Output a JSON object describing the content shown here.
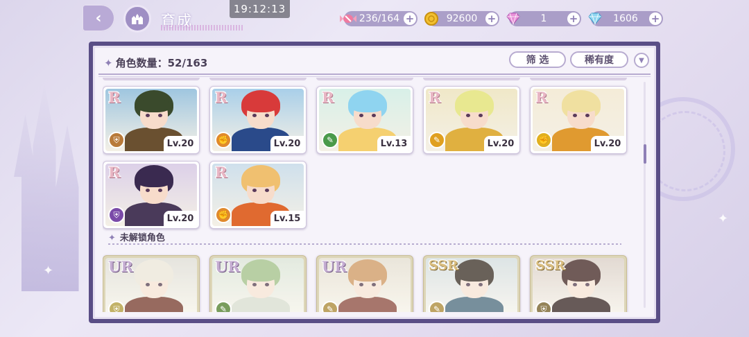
{
  "topbar": {
    "title": "育成",
    "clock": "19:12:13",
    "currencies": [
      {
        "name": "candy-icon",
        "value": "236/164"
      },
      {
        "name": "gold-coin-icon",
        "value": "92600"
      },
      {
        "name": "pink-gem-icon",
        "value": "1"
      },
      {
        "name": "blue-diamond-icon",
        "value": "1606"
      }
    ],
    "plus": "+"
  },
  "header": {
    "count_label": "角色数量",
    "count_value": "52/163",
    "filter_label": "筛 选",
    "rarity_label": "稀有度",
    "sort_glyph": "▼"
  },
  "owned_cards": [
    {
      "rarity": "R",
      "level": "Lv.20",
      "element": "shield-icon",
      "elem_color": "#b87a3a",
      "hair": "#3a4a2c",
      "body": "#6a5030",
      "sky": "#9fc6e0"
    },
    {
      "rarity": "R",
      "level": "Lv.20",
      "element": "fist-icon",
      "elem_color": "#e08a2c",
      "hair": "#d83a3a",
      "body": "#2a4a8a",
      "sky": "#a9cfe9"
    },
    {
      "rarity": "R",
      "level": "Lv.13",
      "element": "wand-icon",
      "elem_color": "#4a9a4a",
      "hair": "#8fd4f0",
      "body": "#f5d070",
      "sky": "#d8f0e8"
    },
    {
      "rarity": "R",
      "level": "Lv.20",
      "element": "wand-icon",
      "elem_color": "#e0a020",
      "hair": "#e8e890",
      "body": "#e0b040",
      "sky": "#f0e8c8"
    },
    {
      "rarity": "R",
      "level": "Lv.20",
      "element": "fist-icon",
      "elem_color": "#e0b020",
      "hair": "#f0e0a0",
      "body": "#e09a30",
      "sky": "#f4ecd8"
    },
    {
      "rarity": "R",
      "level": "Lv.20",
      "element": "shield-icon",
      "elem_color": "#7a4aa8",
      "hair": "#3a2a50",
      "body": "#4a3a5a",
      "sky": "#dcd0e8"
    },
    {
      "rarity": "R",
      "level": "Lv.15",
      "element": "fist-icon",
      "elem_color": "#e08a2c",
      "hair": "#f0c070",
      "body": "#e06a30",
      "sky": "#cfe0ec"
    }
  ],
  "locked_section": {
    "title": "未解锁角色"
  },
  "locked_cards": [
    {
      "rarity": "UR",
      "element": "shield-icon",
      "elem_color": "#c8b040",
      "hair": "#e8e0d0",
      "body": "#8a3020",
      "sky": "#d8d8d0"
    },
    {
      "rarity": "UR",
      "element": "wand-icon",
      "elem_color": "#6aa040",
      "hair": "#90c070",
      "body": "#d0d8c8",
      "sky": "#d0e0d0"
    },
    {
      "rarity": "UR",
      "element": "wand-icon",
      "elem_color": "#c8a040",
      "hair": "#e09040",
      "body": "#a04030",
      "sky": "#e0d8c8"
    },
    {
      "rarity": "SSR",
      "element": "wand-icon",
      "elem_color": "#c8a040",
      "hair": "#3a2a20",
      "body": "#3a6a8a",
      "sky": "#c8d8e0"
    },
    {
      "rarity": "SSR",
      "element": "shield-icon",
      "elem_color": "#9a8040",
      "hair": "#4a2020",
      "body": "#3a2020",
      "sky": "#d8c8c0"
    }
  ]
}
